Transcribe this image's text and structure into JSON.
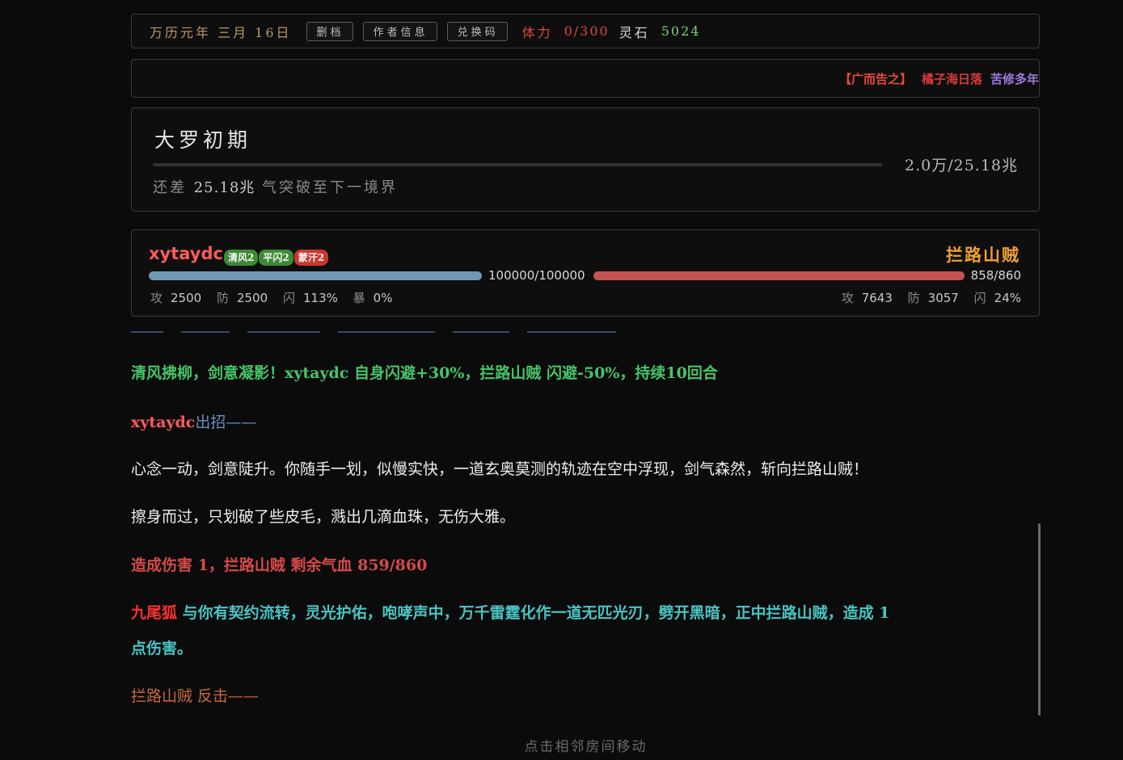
{
  "topbar": {
    "date": "万历元年 三月 16日",
    "buttons": [
      "删档",
      "作者信息",
      "兑换码"
    ],
    "stamina_label": "体力",
    "stamina_value": "0/300",
    "spirit_stone_label": "灵石",
    "spirit_stone_value": "5024"
  },
  "ad": {
    "tag": "【广而告之】",
    "text1": "橘子海日落",
    "text2": "苦修多年"
  },
  "realm": {
    "title": "大罗初期",
    "progress": "2.0万/25.18兆",
    "progress_fraction": 1e-07,
    "remaining_prefix": "还差",
    "remaining_value": "25.18兆",
    "remaining_suffix": "气突破至下一境界"
  },
  "battle": {
    "player": {
      "name": "xytaydc",
      "tags": [
        {
          "label": "清风2",
          "color": "#3d8a35"
        },
        {
          "label": "平闪2",
          "color": "#3d8a35"
        },
        {
          "label": "蒙汗2",
          "color": "#c8382e"
        }
      ],
      "hp": "100000/100000",
      "hp_fraction": 1.0,
      "stats": [
        {
          "label": "攻",
          "value": "2500"
        },
        {
          "label": "防",
          "value": "2500"
        },
        {
          "label": "闪",
          "value": "113%"
        },
        {
          "label": "暴",
          "value": "0%"
        }
      ]
    },
    "enemy": {
      "name": "拦路山贼",
      "hp": "858/860",
      "hp_fraction": 0.9977,
      "stats": [
        {
          "label": "攻",
          "value": "7643"
        },
        {
          "label": "防",
          "value": "3057"
        },
        {
          "label": "闪",
          "value": "24%"
        }
      ]
    }
  },
  "log": {
    "line1": "清风拂柳，剑意凝影！xytaydc 自身闪避+30%，拦路山贼 闪避-50%，持续10回合",
    "line2_name": "xytaydc",
    "line2_action": "出招——",
    "line3": "心念一动，剑意陡升。你随手一划，似慢实快，一道玄奥莫测的轨迹在空中浮现，剑气森然，斩向拦路山贼！",
    "line4": "擦身而过，只划破了些皮毛，溅出几滴血珠，无伤大雅。",
    "line5": "造成伤害 1，拦路山贼 剩余气血 859/860",
    "line6_name": "九尾狐",
    "line6_text": "与你有契约流转，灵光护佑，咆哮声中，万千雷霆化作一道无匹光刃，劈开黑暗，正中拦路山贼，造成 1",
    "line6_cont": "点伤害。",
    "line7": "拦路山贼 反击——"
  },
  "footer_hint": "点击相邻房间移动"
}
